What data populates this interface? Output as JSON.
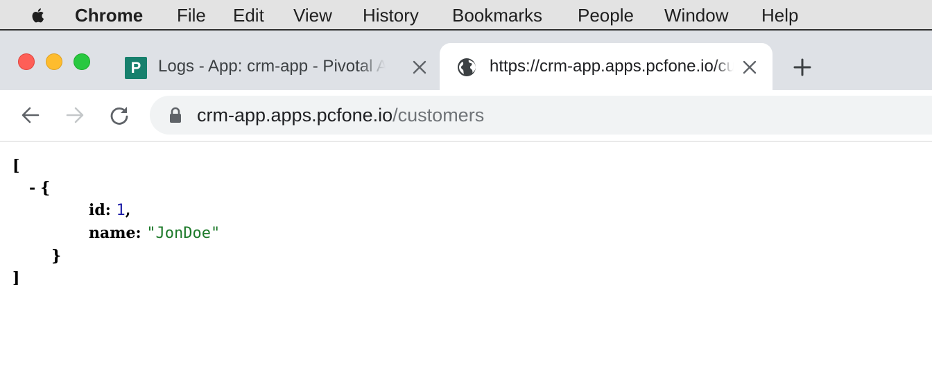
{
  "menubar": {
    "app": "Chrome",
    "items": [
      "File",
      "Edit",
      "View",
      "History",
      "Bookmarks",
      "People",
      "Window",
      "Help"
    ],
    "icons": {
      "apple": "apple-icon"
    }
  },
  "tabs": [
    {
      "title": "Logs - App: crm-app - Pivotal Apps Manager",
      "favicon": "P",
      "active": false
    },
    {
      "title": "https://crm-app.apps.pcfone.io/customers",
      "favicon": "globe-icon",
      "active": true
    }
  ],
  "toolbar": {
    "url_host": "crm-app.apps.pcfone.io",
    "url_path": "/customers"
  },
  "json_view": {
    "open_bracket": "[",
    "collapse_toggle": "-",
    "open_brace": "{",
    "fields": [
      {
        "key": "id",
        "value": "1",
        "trailing": ","
      },
      {
        "key": "name",
        "value": "\"JonDoe\"",
        "trailing": ""
      }
    ],
    "close_brace": "}",
    "close_bracket": "]"
  },
  "colors": {
    "menubar_bg": "#e3e3e3",
    "tabstrip_bg": "#dee1e6",
    "omnibox_bg": "#f1f3f4",
    "number": "#1a1aa6",
    "string": "#1d7a2a"
  }
}
